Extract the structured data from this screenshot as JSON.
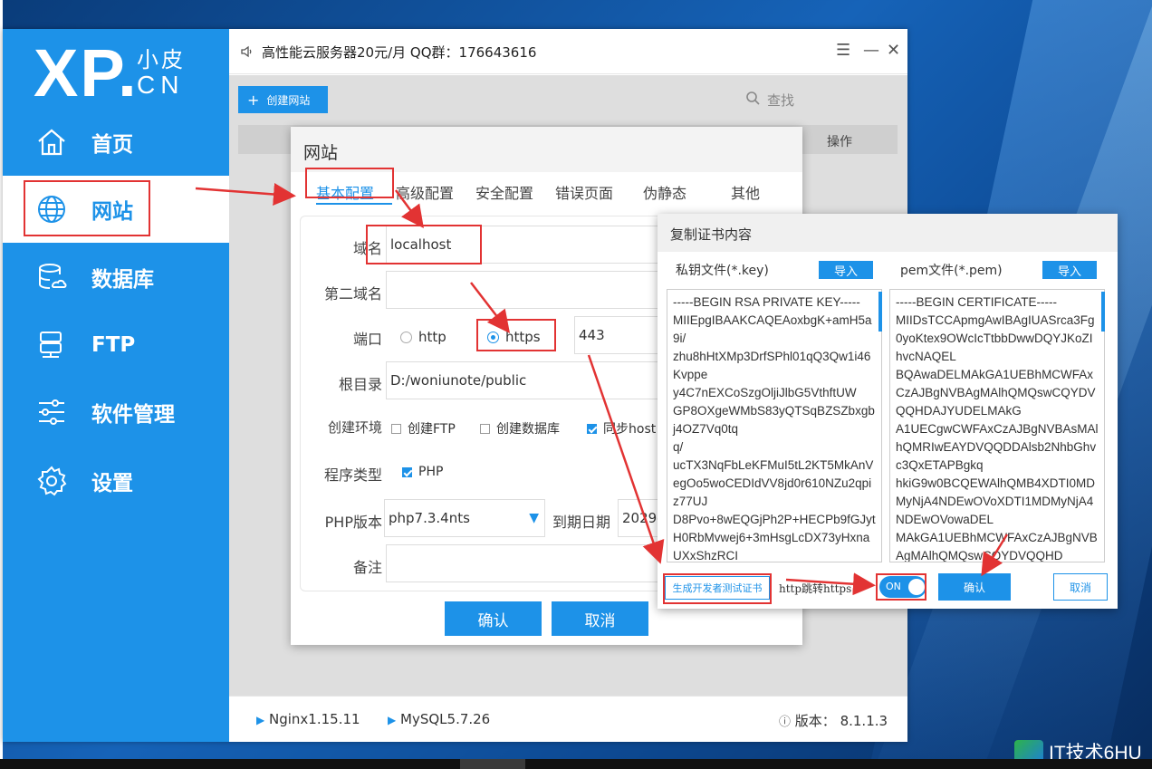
{
  "app": {
    "logo_main": "XP.",
    "logo_cn_top": "小皮",
    "logo_cn_bottom": "CN",
    "title": "高性能云服务器20元/月 QQ群：176643616",
    "window_controls": [
      "menu-icon",
      "minimize-icon",
      "close-icon"
    ]
  },
  "sidebar": {
    "items": [
      {
        "label": "首页",
        "icon": "home-icon"
      },
      {
        "label": "网站",
        "icon": "globe-icon",
        "active": true
      },
      {
        "label": "数据库",
        "icon": "database-icon"
      },
      {
        "label": "FTP",
        "icon": "server-icon"
      },
      {
        "label": "软件管理",
        "icon": "sliders-icon"
      },
      {
        "label": "设置",
        "icon": "gear-icon"
      }
    ]
  },
  "toolbar": {
    "create_label": "创建网站",
    "search_label": "查找",
    "column_op": "操作"
  },
  "status": {
    "nginx": "Nginx1.15.11",
    "mysql": "MySQL5.7.26",
    "version": "版本：  8.1.1.3"
  },
  "dialog": {
    "title": "网站",
    "tabs": [
      "基本配置",
      "高级配置",
      "安全配置",
      "错误页面",
      "伪静态",
      "其他"
    ],
    "active_tab": "基本配置",
    "domain_label": "域名",
    "domain_value": "localhost",
    "second_domain_label": "第二域名",
    "second_domain_value": "",
    "port_label": "端口",
    "port_http": "http",
    "port_https": "https",
    "port_value": "443",
    "root_label": "根目录",
    "root_value": "D:/woniunote/public",
    "env_label": "创建环境",
    "env_options": [
      {
        "label": "创建FTP",
        "checked": false
      },
      {
        "label": "创建数据库",
        "checked": false
      },
      {
        "label": "同步host",
        "checked": true
      }
    ],
    "type_label": "程序类型",
    "type_option": "PHP",
    "php_label": "PHP版本",
    "php_value": "php7.3.4nts",
    "expire_label": "到期日期",
    "expire_value": "2029-",
    "note_label": "备注",
    "ok_label": "确认",
    "cancel_label": "取消"
  },
  "cert": {
    "title": "复制证书内容",
    "key_label": "私钥文件(*.key)",
    "pem_label": "pem文件(*.pem)",
    "import_label": "导入",
    "key_text": "-----BEGIN RSA PRIVATE KEY-----\nMIIEpgIBAAKCAQEAoxbgK+amH5a9i/\nzhu8hHtXMp3DrfSPhl01qQ3Qw1i46Kvppe\ny4C7nEXCoSzgOljiJlbG5VthftUW\nGP8OXgeWMbS83yQTSqBZSZbxgbj4OZ7Vq0tq\nq/\nucTX3NqFbLeKFMuI5tL2KT5MkAnVegOo5woCEDIdVV8jd0r610NZu2qpiz77UJ\nD8Pvo+8wEQGjPh2P+HECPb9fGJytH0RbMvwej6+3mHsgLcDX73yHxnaUXxShzRCI",
    "pem_text": "-----BEGIN CERTIFICATE-----\nMIIDsTCCApmgAwIBAgIUASrca3Fg0yoKtex9OWcIcTtbbDwwDQYJKoZIhvcNAQEL\nBQAwaDELMAkGA1UEBhMCWFAxCzAJBgNVBAgMAlhQMQswCQYDVQQHDAJYUDELMAkG\nA1UECgwCWFAxCzAJBgNVBAsMAlhQMRIwEAYDVQQDDAlsb2NhbGhvc3QxETAPBgkq\nhkiG9w0BCQEWAlhQMB4XDTI0MDMyNjA4NDEwOVoXDTI1MDMyNjA4NDEwOVowaDEL\nMAkGA1UEBhMCWFAxCzAJBgNVBAgMAlhQMQswCQYDVQQHD",
    "gen_label": "生成开发者测试证书",
    "redirect_label": "http跳转https",
    "toggle_label": "ON",
    "ok_label": "确认",
    "cancel_label": "取消"
  },
  "watermark": "IT技术6HU",
  "colors": {
    "accent": "#1d92e8",
    "annotation": "#e23333"
  }
}
